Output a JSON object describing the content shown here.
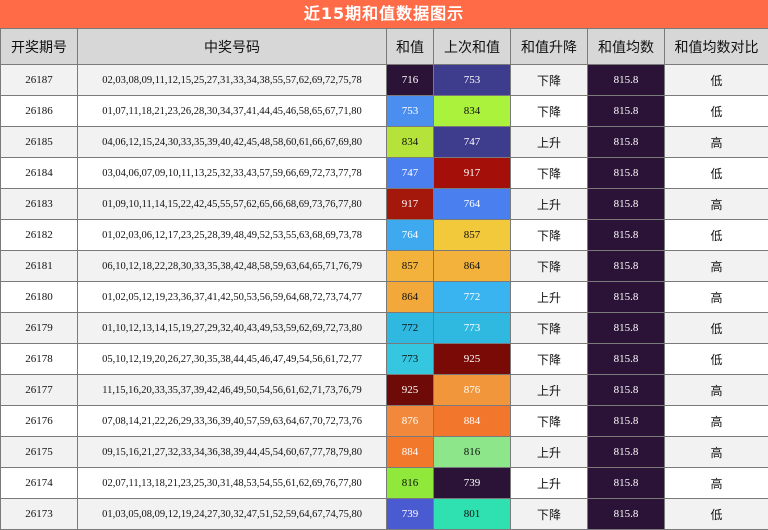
{
  "title": "近15期和值数据图示",
  "headers": [
    "开奖期号",
    "中奖号码",
    "和值",
    "上次和值",
    "和值升降",
    "和值均数",
    "和值均数对比"
  ],
  "rows": [
    {
      "issue": "26187",
      "numbers": "02,03,08,09,11,12,15,25,27,31,33,34,38,55,57,62,69,72,75,78",
      "sum": "716",
      "sum_bg": "#2b1338",
      "sum_fg": "#ffffff",
      "prev": "753",
      "prev_bg": "#3e3c8c",
      "prev_fg": "#ffffff",
      "trend": "下降",
      "avg": "815.8",
      "cmp": "低"
    },
    {
      "issue": "26186",
      "numbers": "01,07,11,18,21,23,26,28,30,34,37,41,44,45,46,58,65,67,71,80",
      "sum": "753",
      "sum_bg": "#4a8ef0",
      "sum_fg": "#ffffff",
      "prev": "834",
      "prev_bg": "#aaf23c",
      "prev_fg": "#111111",
      "trend": "下降",
      "avg": "815.8",
      "cmp": "低"
    },
    {
      "issue": "26185",
      "numbers": "04,06,12,15,24,30,33,35,39,40,42,45,48,58,60,61,66,67,69,80",
      "sum": "834",
      "sum_bg": "#b6e33a",
      "sum_fg": "#111111",
      "prev": "747",
      "prev_bg": "#3e3c8c",
      "prev_fg": "#ffffff",
      "trend": "上升",
      "avg": "815.8",
      "cmp": "高"
    },
    {
      "issue": "26184",
      "numbers": "03,04,06,07,09,10,11,13,25,32,33,43,57,59,66,69,72,73,77,78",
      "sum": "747",
      "sum_bg": "#4a7ff0",
      "sum_fg": "#ffffff",
      "prev": "917",
      "prev_bg": "#a50f0a",
      "prev_fg": "#ffffff",
      "trend": "下降",
      "avg": "815.8",
      "cmp": "低"
    },
    {
      "issue": "26183",
      "numbers": "01,09,10,11,14,15,22,42,45,55,57,62,65,66,68,69,73,76,77,80",
      "sum": "917",
      "sum_bg": "#a3180b",
      "sum_fg": "#ffffff",
      "prev": "764",
      "prev_bg": "#4a7ff0",
      "prev_fg": "#ffffff",
      "trend": "上升",
      "avg": "815.8",
      "cmp": "高"
    },
    {
      "issue": "26182",
      "numbers": "01,02,03,06,12,17,23,25,28,39,48,49,52,53,55,63,68,69,73,78",
      "sum": "764",
      "sum_bg": "#3fa9f0",
      "sum_fg": "#ffffff",
      "prev": "857",
      "prev_bg": "#f2c93b",
      "prev_fg": "#111111",
      "trend": "下降",
      "avg": "815.8",
      "cmp": "低"
    },
    {
      "issue": "26181",
      "numbers": "06,10,12,18,22,28,30,33,35,38,42,48,58,59,63,64,65,71,76,79",
      "sum": "857",
      "sum_bg": "#f2b23b",
      "sum_fg": "#111111",
      "prev": "864",
      "prev_bg": "#f2b23b",
      "prev_fg": "#111111",
      "trend": "下降",
      "avg": "815.8",
      "cmp": "高"
    },
    {
      "issue": "26180",
      "numbers": "01,02,05,12,19,23,36,37,41,42,50,53,56,59,64,68,72,73,74,77",
      "sum": "864",
      "sum_bg": "#f2a83b",
      "sum_fg": "#111111",
      "prev": "772",
      "prev_bg": "#3ab4f0",
      "prev_fg": "#ffffff",
      "trend": "上升",
      "avg": "815.8",
      "cmp": "高"
    },
    {
      "issue": "26179",
      "numbers": "01,10,12,13,14,15,19,27,29,32,40,43,49,53,59,62,69,72,73,80",
      "sum": "772",
      "sum_bg": "#2fb8e0",
      "sum_fg": "#111111",
      "prev": "773",
      "prev_bg": "#2fb8e0",
      "prev_fg": "#ffffff",
      "trend": "下降",
      "avg": "815.8",
      "cmp": "低"
    },
    {
      "issue": "26178",
      "numbers": "05,10,12,19,20,26,27,30,35,38,44,45,46,47,49,54,56,61,72,77",
      "sum": "773",
      "sum_bg": "#35c6e0",
      "sum_fg": "#111111",
      "prev": "925",
      "prev_bg": "#7a0a06",
      "prev_fg": "#ffffff",
      "trend": "下降",
      "avg": "815.8",
      "cmp": "低"
    },
    {
      "issue": "26177",
      "numbers": "11,15,16,20,33,35,37,39,42,46,49,50,54,56,61,62,71,73,76,79",
      "sum": "925",
      "sum_bg": "#6e0a08",
      "sum_fg": "#ffffff",
      "prev": "876",
      "prev_bg": "#f2963b",
      "prev_fg": "#ffffff",
      "trend": "上升",
      "avg": "815.8",
      "cmp": "高"
    },
    {
      "issue": "26176",
      "numbers": "07,08,14,21,22,26,29,33,36,39,40,57,59,63,64,67,70,72,73,76",
      "sum": "876",
      "sum_bg": "#f2883b",
      "sum_fg": "#ffffff",
      "prev": "884",
      "prev_bg": "#f2762b",
      "prev_fg": "#ffffff",
      "trend": "下降",
      "avg": "815.8",
      "cmp": "高"
    },
    {
      "issue": "26175",
      "numbers": "09,15,16,21,27,32,33,34,36,38,39,44,45,54,60,67,77,78,79,80",
      "sum": "884",
      "sum_bg": "#f2782b",
      "sum_fg": "#ffffff",
      "prev": "816",
      "prev_bg": "#8ee68a",
      "prev_fg": "#111111",
      "trend": "上升",
      "avg": "815.8",
      "cmp": "高"
    },
    {
      "issue": "26174",
      "numbers": "02,07,11,13,18,21,23,25,30,31,48,53,54,55,61,62,69,76,77,80",
      "sum": "816",
      "sum_bg": "#8fe83a",
      "sum_fg": "#111111",
      "prev": "739",
      "prev_bg": "#2b1338",
      "prev_fg": "#ffffff",
      "trend": "上升",
      "avg": "815.8",
      "cmp": "高"
    },
    {
      "issue": "26173",
      "numbers": "01,03,05,08,09,12,19,24,27,30,32,47,51,52,59,64,67,74,75,80",
      "sum": "739",
      "sum_bg": "#4a5ad0",
      "sum_fg": "#ffffff",
      "prev": "801",
      "prev_bg": "#2fe0b0",
      "prev_fg": "#111111",
      "trend": "下降",
      "avg": "815.8",
      "cmp": "低"
    }
  ]
}
